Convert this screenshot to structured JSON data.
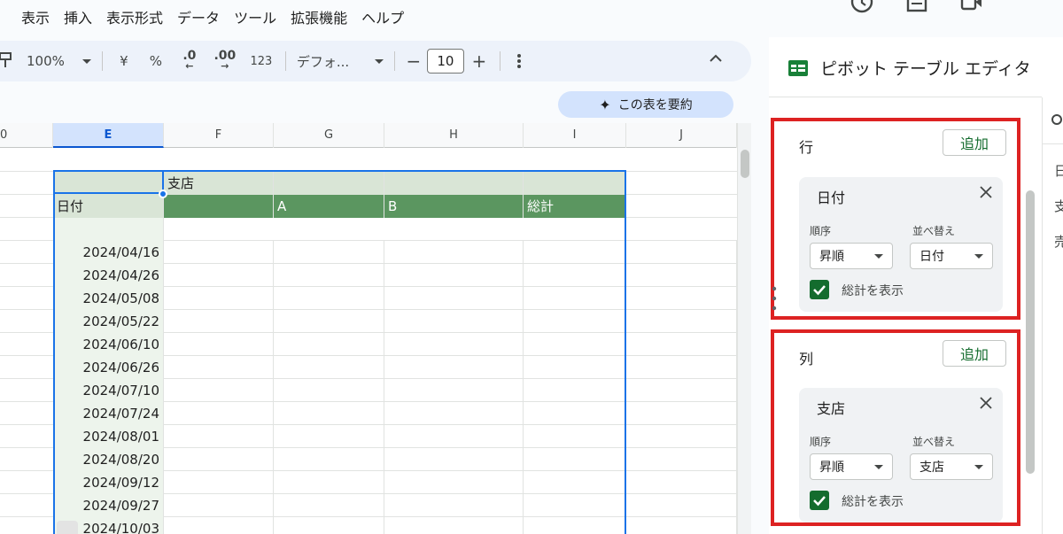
{
  "menu": [
    "表示",
    "挿入",
    "表示形式",
    "データ",
    "ツール",
    "拡張機能",
    "ヘルプ"
  ],
  "toolbar": {
    "zoom": "100%",
    "currency": "¥",
    "percent": "%",
    "dec_decrease": ".0",
    "dec_increase": ".00",
    "number_format": "123",
    "font": "デフォ...",
    "minus": "−",
    "font_size": "10",
    "plus": "+"
  },
  "summarize_label": "この表を要約",
  "columns": [
    "0",
    "E",
    "F",
    "G",
    "H",
    "I",
    "J"
  ],
  "pivot": {
    "header_row1": {
      "E": "",
      "F": "支店"
    },
    "header_row2": {
      "E": "日付",
      "G": "A",
      "H": "B",
      "I": "総計"
    },
    "dates": [
      "2024/04/16",
      "2024/04/26",
      "2024/05/08",
      "2024/05/22",
      "2024/06/10",
      "2024/06/26",
      "2024/07/10",
      "2024/07/24",
      "2024/08/01",
      "2024/08/20",
      "2024/09/12",
      "2024/09/27",
      "2024/10/03"
    ]
  },
  "panel": {
    "title": "ピボット テーブル エディタ",
    "side_chars": [
      "日",
      "支",
      "売"
    ],
    "rows_section": {
      "title": "行",
      "add": "追加",
      "field": "日付",
      "order_label": "順序",
      "order_value": "昇順",
      "sort_label": "並べ替え",
      "sort_value": "日付",
      "show_totals": "総計を表示"
    },
    "cols_section": {
      "title": "列",
      "add": "追加",
      "field": "支店",
      "order_label": "順序",
      "order_value": "昇順",
      "sort_label": "並べ替え",
      "sort_value": "支店",
      "show_totals": "総計を表示"
    }
  },
  "colors": {
    "accent": "#1a73e8",
    "pivot_header": "#5b9660",
    "highlight": "#dd2222",
    "checkbox": "#146c2e"
  }
}
